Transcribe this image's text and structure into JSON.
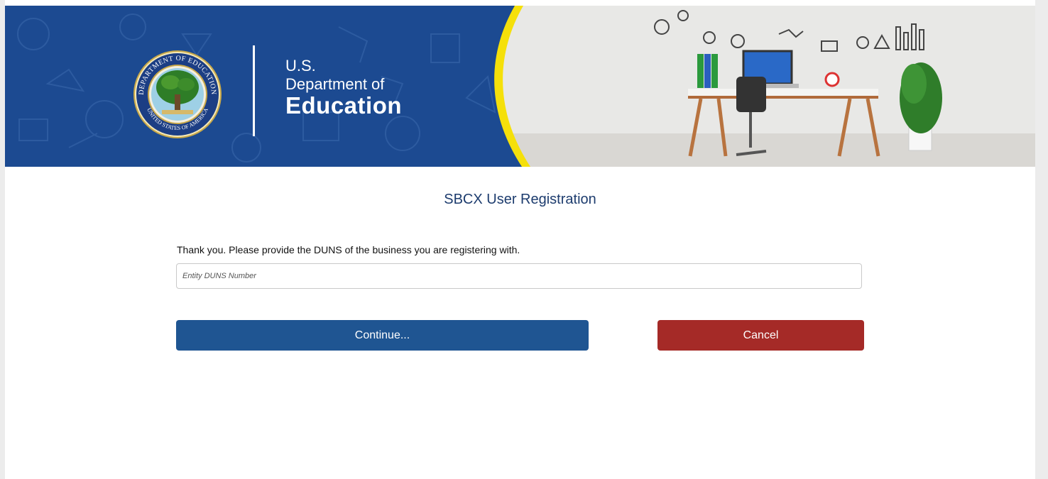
{
  "header": {
    "agency_line1": "U.S.",
    "agency_line2": "Department of",
    "agency_line3": "Education",
    "seal_top_text": "DEPARTMENT OF EDUCATION",
    "seal_bottom_text": "UNITED STATES OF AMERICA"
  },
  "main": {
    "title": "SBCX User Registration",
    "prompt": "Thank you. Please provide the DUNS of the business you are registering with.",
    "duns_input": {
      "value": "",
      "placeholder": "Entity DUNS Number"
    },
    "continue_label": "Continue...",
    "cancel_label": "Cancel"
  },
  "colors": {
    "banner_blue": "#1c4a91",
    "accent_yellow": "#f5e00a",
    "title_navy": "#1d3c6e",
    "continue_blue": "#1f5592",
    "cancel_red": "#a52a27"
  }
}
